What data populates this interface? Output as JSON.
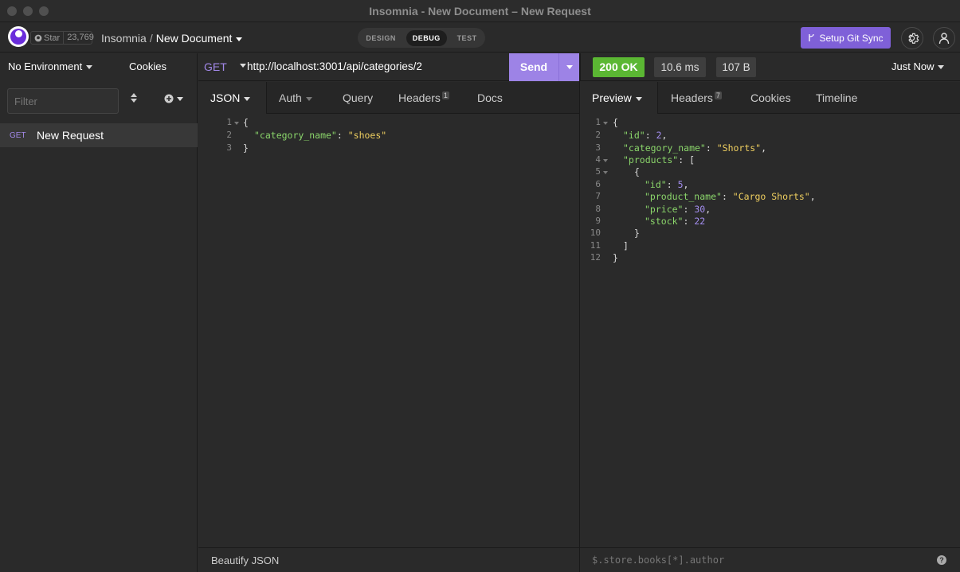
{
  "window": {
    "title": "Insomnia - New Document – New Request"
  },
  "header": {
    "star_label": "Star",
    "star_count": "23,769",
    "app_name": "Insomnia",
    "separator": "/",
    "document_name": "New Document",
    "modes": [
      "DESIGN",
      "DEBUG",
      "TEST"
    ],
    "active_mode": "DEBUG",
    "git_sync_label": "Setup Git Sync"
  },
  "sidebar": {
    "environment": "No Environment",
    "cookies": "Cookies",
    "filter_placeholder": "Filter",
    "requests": [
      {
        "method": "GET",
        "name": "New Request"
      }
    ]
  },
  "request": {
    "method": "GET",
    "url": "http://localhost:3001/api/categories/2",
    "send_label": "Send",
    "tabs": {
      "body": "JSON",
      "auth": "Auth",
      "query": "Query",
      "headers": "Headers",
      "headers_count": "1",
      "docs": "Docs"
    },
    "body_lines": [
      "1",
      "2",
      "3"
    ],
    "body_key": "\"category_name\"",
    "body_value": "\"shoes\"",
    "footer_label": "Beautify JSON"
  },
  "response": {
    "status": "200 OK",
    "time": "10.6 ms",
    "size": "107 B",
    "history": "Just Now",
    "tabs": {
      "preview": "Preview",
      "headers": "Headers",
      "headers_count": "7",
      "cookies": "Cookies",
      "timeline": "Timeline"
    },
    "line_numbers": [
      "1",
      "2",
      "3",
      "4",
      "5",
      "6",
      "7",
      "8",
      "9",
      "10",
      "11",
      "12"
    ],
    "json": {
      "id_key": "\"id\"",
      "id_val": "2",
      "cat_key": "\"category_name\"",
      "cat_val": "\"Shorts\"",
      "products_key": "\"products\"",
      "p_id_key": "\"id\"",
      "p_id_val": "5",
      "p_name_key": "\"product_name\"",
      "p_name_val": "\"Cargo Shorts\"",
      "p_price_key": "\"price\"",
      "p_price_val": "30",
      "p_stock_key": "\"stock\"",
      "p_stock_val": "22"
    },
    "filter_placeholder": "$.store.books[*].author"
  }
}
